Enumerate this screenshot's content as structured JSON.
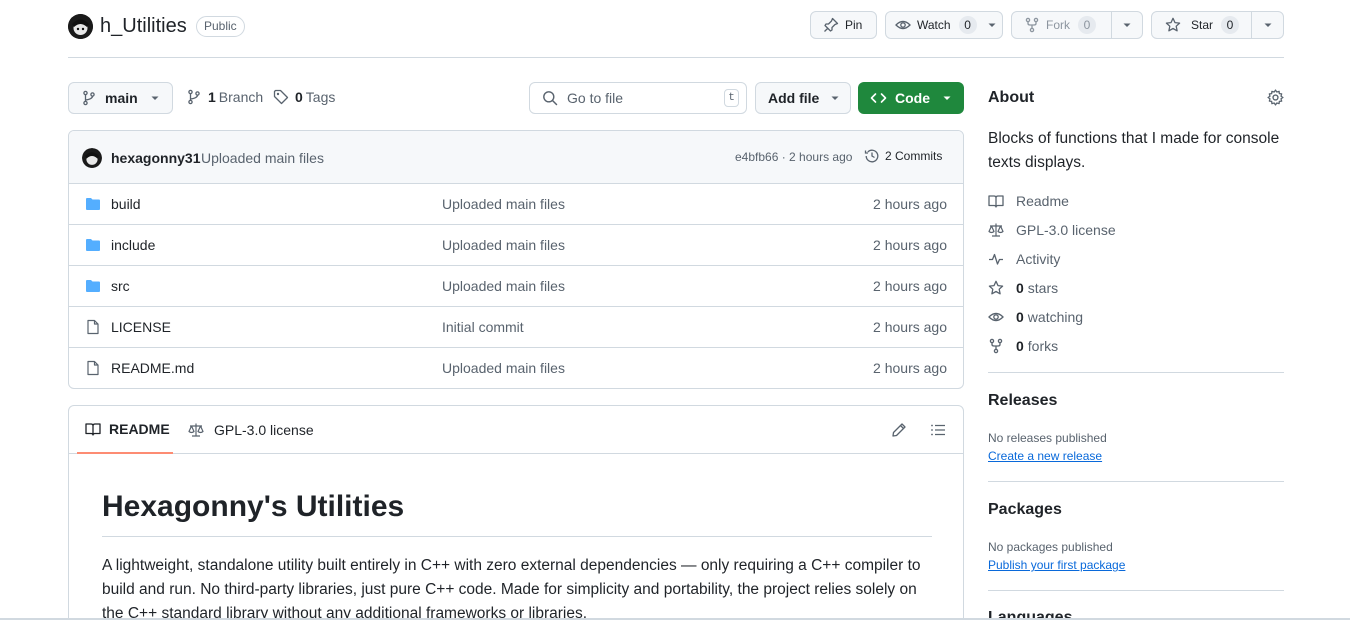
{
  "repo": {
    "name": "h_Utilities",
    "visibility": "Public"
  },
  "header_actions": {
    "pin_label": "Pin",
    "watch_label": "Watch",
    "watch_count": "0",
    "fork_label": "Fork",
    "fork_count": "0",
    "star_label": "Star",
    "star_count": "0"
  },
  "toolbar": {
    "branch": "main",
    "branches_count": "1",
    "branches_label": "Branch",
    "tags_count": "0",
    "tags_label": "Tags",
    "search_placeholder": "Go to file",
    "search_shortcut": "t",
    "add_file_label": "Add file",
    "code_label": "Code"
  },
  "latest_commit": {
    "author": "hexagonny31",
    "message": "Uploaded main files",
    "sha_time": "e4bfb66 · 2 hours ago",
    "commits_label": "2 Commits"
  },
  "files": [
    {
      "name": "build",
      "type": "folder",
      "message": "Uploaded main files",
      "time": "2 hours ago"
    },
    {
      "name": "include",
      "type": "folder",
      "message": "Uploaded main files",
      "time": "2 hours ago"
    },
    {
      "name": "src",
      "type": "folder",
      "message": "Uploaded main files",
      "time": "2 hours ago"
    },
    {
      "name": "LICENSE",
      "type": "file",
      "message": "Initial commit",
      "time": "2 hours ago"
    },
    {
      "name": "README.md",
      "type": "file",
      "message": "Uploaded main files",
      "time": "2 hours ago"
    }
  ],
  "readme": {
    "tab_readme": "README",
    "tab_license": "GPL-3.0 license",
    "title": "Hexagonny's Utilities",
    "paragraph": "A lightweight, standalone utility built entirely in C++ with zero external dependencies — only requiring a C++ compiler to build and run. No third-party libraries, just pure C++ code. Made for simplicity and portability, the project relies solely on the C++ standard library without any additional frameworks or libraries."
  },
  "about": {
    "title": "About",
    "description": "Blocks of functions that I made for console texts displays.",
    "readme_label": "Readme",
    "license_label": "GPL-3.0 license",
    "activity_label": "Activity",
    "stars_count": "0",
    "stars_label": "stars",
    "watching_count": "0",
    "watching_label": "watching",
    "forks_count": "0",
    "forks_label": "forks"
  },
  "releases": {
    "title": "Releases",
    "empty_text": "No releases published",
    "link": "Create a new release"
  },
  "packages": {
    "title": "Packages",
    "empty_text": "No packages published",
    "link": "Publish your first package"
  },
  "languages": {
    "title": "Languages"
  },
  "colors": {
    "accent_green": "#1f883d",
    "link_blue": "#0969da",
    "folder_blue": "#54aeff",
    "tab_underline": "#fd8c73"
  }
}
